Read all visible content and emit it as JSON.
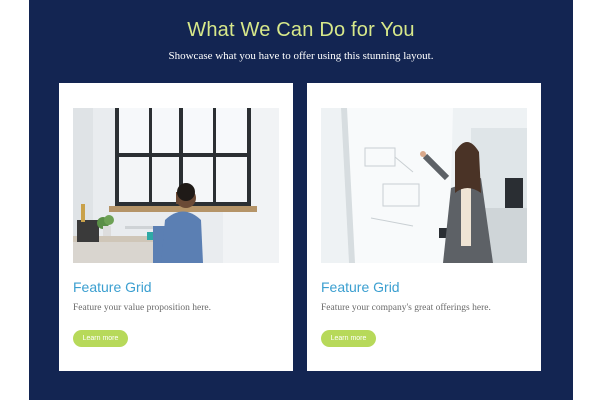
{
  "section": {
    "heading": "What We Can Do for You",
    "subheading": "Showcase what you have to offer using this stunning layout."
  },
  "cards": [
    {
      "title": "Feature Grid",
      "text": "Feature your value proposition here.",
      "button_label": "Learn more",
      "image": "photo-man-on-phone-at-desk"
    },
    {
      "title": "Feature Grid",
      "text": "Feature your company's great offerings here.",
      "button_label": "Learn more",
      "image": "photo-woman-writing-on-whiteboard"
    }
  ],
  "colors": {
    "section_background": "#132552",
    "heading": "#d7e88a",
    "card_title": "#3b9fd0",
    "button": "#b7d95a"
  }
}
